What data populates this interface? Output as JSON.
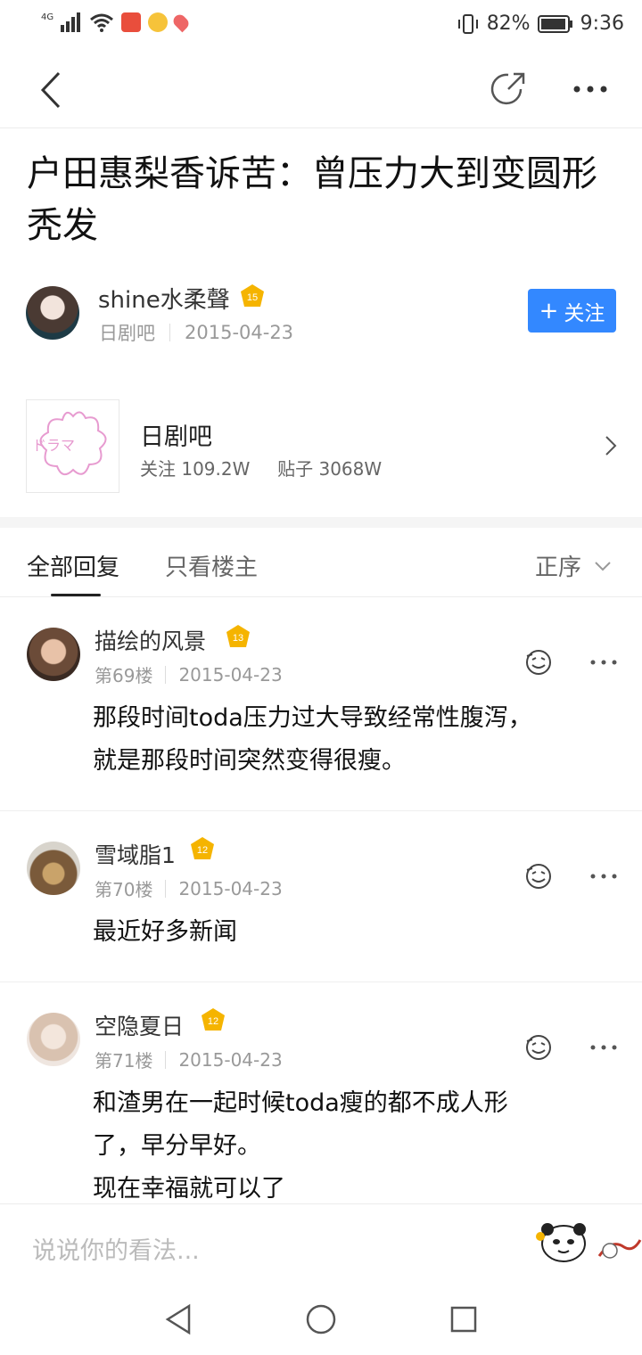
{
  "status_bar": {
    "network": "4G",
    "battery": "82%",
    "time": "9:36"
  },
  "nav": {
    "back_icon": "chevron-left-icon",
    "share_icon": "share-icon",
    "more_icon": "more-icon"
  },
  "post": {
    "title": "户田惠梨香诉苦：曾压力大到变圆形秃发",
    "author": {
      "name": "shine水柔聲",
      "level": "15",
      "forum": "日剧吧",
      "date": "2015-04-23"
    },
    "follow_label": "关注"
  },
  "forum_card": {
    "name": "日剧吧",
    "follow_stat": "关注 109.2W",
    "posts_stat": "贴子 3068W",
    "logo_text": "ドラマ"
  },
  "tabs": {
    "all": "全部回复",
    "owner_only": "只看楼主",
    "sort": "正序"
  },
  "replies": [
    {
      "name": "描绘的风景",
      "level": "13",
      "floor": "第69楼",
      "date": "2015-04-23",
      "text": "那段时间toda压力过大导致经常性腹泻，\n就是那段时间突然变得很瘦。"
    },
    {
      "name": "雪域脂1",
      "level": "12",
      "floor": "第70楼",
      "date": "2015-04-23",
      "text": "最近好多新闻"
    },
    {
      "name": "空隐夏日",
      "level": "12",
      "floor": "第71楼",
      "date": "2015-04-23",
      "text": "和渣男在一起时候toda瘦的都不成人形\n了，早分早好。\n现在幸福就可以了"
    }
  ],
  "composer": {
    "placeholder": "说说你的看法..."
  },
  "colors": {
    "accent": "#3388ff",
    "badge": "#f5b400"
  }
}
